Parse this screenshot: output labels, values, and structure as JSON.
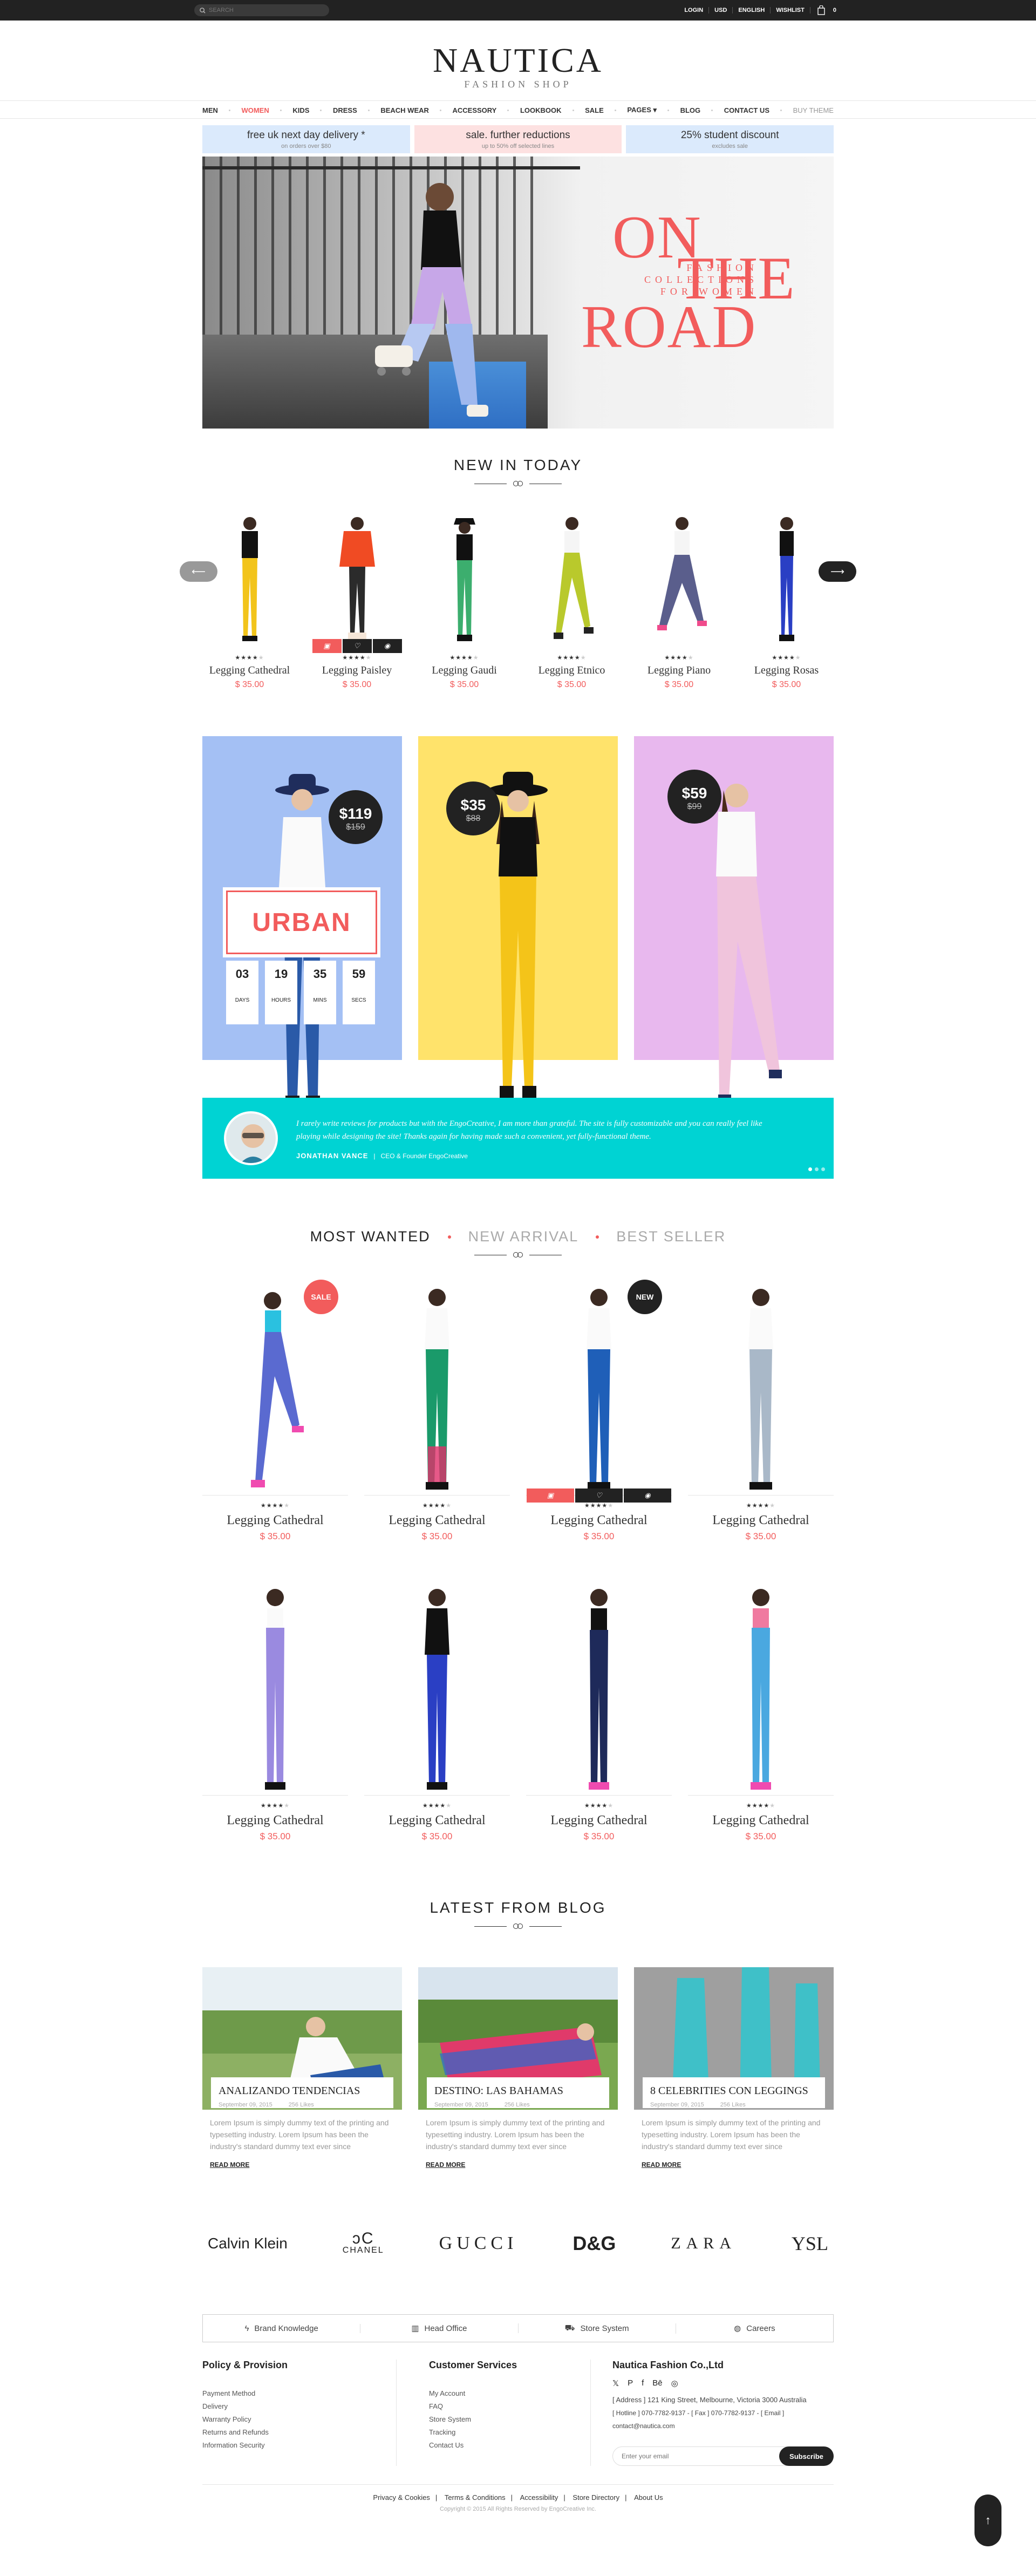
{
  "topbar": {
    "search_placeholder": "SEARCH",
    "links": [
      "LOGIN",
      "USD",
      "ENGLISH",
      "WISHLIST"
    ],
    "cart_count": "0"
  },
  "logo": {
    "name": "NAUTICA",
    "tagline": "FASHION SHOP"
  },
  "nav": [
    "MEN",
    "WOMEN",
    "KIDS",
    "DRESS",
    "BEACH WEAR",
    "ACCESSORY",
    "LOOKBOOK",
    "SALE",
    "PAGES ▾",
    "BLOG",
    "CONTACT US",
    "BUY THEME"
  ],
  "promos": [
    {
      "title": "free uk next day delivery *",
      "sub": "on orders over $80",
      "color": "#dbeafc"
    },
    {
      "title": "sale. further reductions",
      "sub": "up to 50% off selected lines",
      "color": "#fde1e1"
    },
    {
      "title": "25% student discount",
      "sub": "excludes sale",
      "color": "#dbeafc"
    }
  ],
  "hero": {
    "on": "ON",
    "fashion": "FASHION COLLECTIONS FOR WOMEN",
    "the": "THE",
    "road": "ROAD"
  },
  "new_in_today": {
    "title": "NEW IN TODAY",
    "items": [
      {
        "name": "Legging Cathedral",
        "price": "$ 35.00",
        "stars": 4
      },
      {
        "name": "Legging Paisley",
        "price": "$ 35.00",
        "stars": 4
      },
      {
        "name": "Legging Gaudi",
        "price": "$ 35.00",
        "stars": 4
      },
      {
        "name": "Legging Etnico",
        "price": "$ 35.00",
        "stars": 4
      },
      {
        "name": "Legging Piano",
        "price": "$ 35.00",
        "stars": 4
      },
      {
        "name": "Legging Rosas",
        "price": "$ 35.00",
        "stars": 4
      }
    ]
  },
  "banners": [
    {
      "color": "#a4c0f4",
      "price": "$119",
      "old_price": "$159",
      "label": "URBAN",
      "countdown": [
        {
          "n": "03",
          "u": "DAYS"
        },
        {
          "n": "19",
          "u": "HOURS"
        },
        {
          "n": "35",
          "u": "MINS"
        },
        {
          "n": "59",
          "u": "SECS"
        }
      ]
    },
    {
      "color": "#ffe36b",
      "price": "$35",
      "old_price": "$88"
    },
    {
      "color": "#e8b8ee",
      "price": "$59",
      "old_price": "$99"
    }
  ],
  "testimonial": {
    "quote": "I rarely write reviews for products but with the EngoCreative, I am more than grateful. The site is fully customizable and you can really feel like playing while designing the site! Thanks again for having made such a convenient, yet fully-functional theme.",
    "name": "JONATHAN VANCE",
    "role": "CEO & Founder EngoCreative"
  },
  "tabs": {
    "most": "MOST WANTED",
    "new": "NEW ARRIVAL",
    "best": "BEST SELLER"
  },
  "products": [
    {
      "name": "Legging Cathedral",
      "price": "$ 35.00",
      "badge": "SALE"
    },
    {
      "name": "Legging Cathedral",
      "price": "$ 35.00",
      "badge": ""
    },
    {
      "name": "Legging Cathedral",
      "price": "$ 35.00",
      "badge": "NEW"
    },
    {
      "name": "Legging Cathedral",
      "price": "$ 35.00",
      "badge": ""
    },
    {
      "name": "Legging Cathedral",
      "price": "$ 35.00",
      "badge": ""
    },
    {
      "name": "Legging Cathedral",
      "price": "$ 35.00",
      "badge": ""
    },
    {
      "name": "Legging Cathedral",
      "price": "$ 35.00",
      "badge": ""
    },
    {
      "name": "Legging Cathedral",
      "price": "$ 35.00",
      "badge": ""
    }
  ],
  "blog": {
    "title": "LATEST FROM BLOG",
    "posts": [
      {
        "title": "ANALIZANDO TENDENCIAS",
        "date": "September 09, 2015",
        "likes": "256 Likes"
      },
      {
        "title": "DESTINO: LAS BAHAMAS",
        "date": "September 09, 2015",
        "likes": "256 Likes"
      },
      {
        "title": "8 CELEBRITIES CON LEGGINGS",
        "date": "September 09, 2015",
        "likes": "256 Likes"
      }
    ],
    "excerpt": "Lorem Ipsum is simply dummy text of the printing and typesetting industry. Lorem Ipsum has been the industry's standard dummy text ever since",
    "read_more": "READ MORE"
  },
  "brands": [
    "Calvin Klein",
    "CHANEL",
    "GUCCI",
    "D&G",
    "ZARA",
    "YSL"
  ],
  "info_bar": [
    "Brand Knowledge",
    "Head Office",
    "Store System",
    "Careers"
  ],
  "footer": {
    "policy_title": "Policy & Provision",
    "policy_links": [
      "Payment Method",
      "Delivery",
      "Warranty Policy",
      "Returns and Refunds",
      "Information Security"
    ],
    "service_title": "Customer Services",
    "service_links": [
      "My Account",
      "FAQ",
      "Store System",
      "Tracking",
      "Contact Us"
    ],
    "company_title": "Nautica Fashion Co.,Ltd",
    "address": "[ Address ]  121 King Street, Melbourne, Victoria 3000 Australia",
    "contact": "[ Hotline ]  070-7782-9137  -  [ Fax ]  070-7782-9137  -  [ Email ]  contact@nautica.com",
    "email_placeholder": "Enter your email",
    "subscribe": "Subscribe",
    "bottom_links": [
      "Privacy & Cookies",
      "Terms & Conditions",
      "Accessibility",
      "Store Directory",
      "About Us"
    ],
    "copyright": "Copyright © 2015 All Rights Reserved by EngoCreative Inc."
  },
  "colors": {
    "accent": "#f25c5c",
    "dark": "#222222",
    "teal": "#00d3d3"
  }
}
